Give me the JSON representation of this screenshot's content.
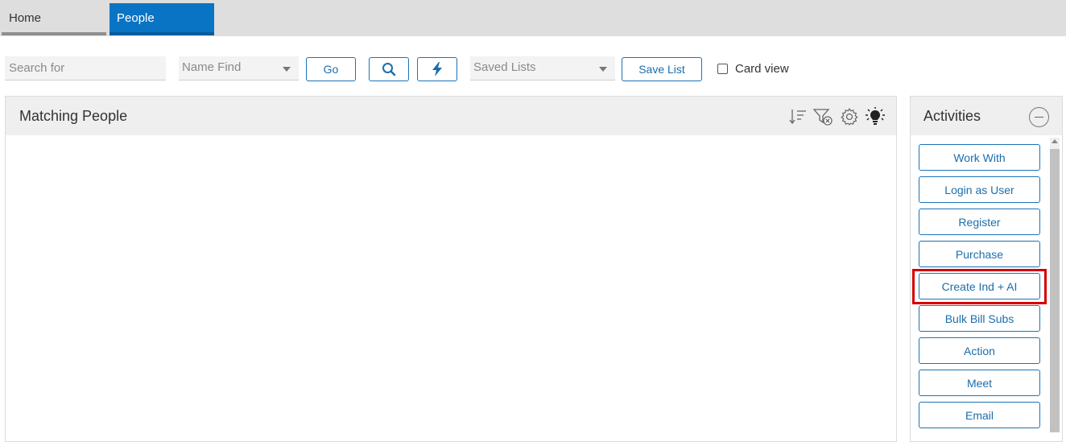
{
  "tabs": [
    {
      "label": "Home"
    },
    {
      "label": "People"
    }
  ],
  "toolbar": {
    "search_placeholder": "Search for",
    "name_find": "Name Find",
    "go_label": "Go",
    "saved_lists": "Saved Lists",
    "save_list_label": "Save List",
    "card_view_label": "Card view"
  },
  "main": {
    "title": "Matching People"
  },
  "activities": {
    "title": "Activities",
    "items": [
      {
        "label": "Work With"
      },
      {
        "label": "Login as User"
      },
      {
        "label": "Register"
      },
      {
        "label": "Purchase"
      },
      {
        "label": "Create Ind + AI"
      },
      {
        "label": "Bulk Bill Subs"
      },
      {
        "label": "Action"
      },
      {
        "label": "Meet"
      },
      {
        "label": "Email"
      }
    ]
  },
  "colors": {
    "accent": "#0a74c4",
    "button_border": "#1b73b8",
    "highlight": "#d40000"
  }
}
